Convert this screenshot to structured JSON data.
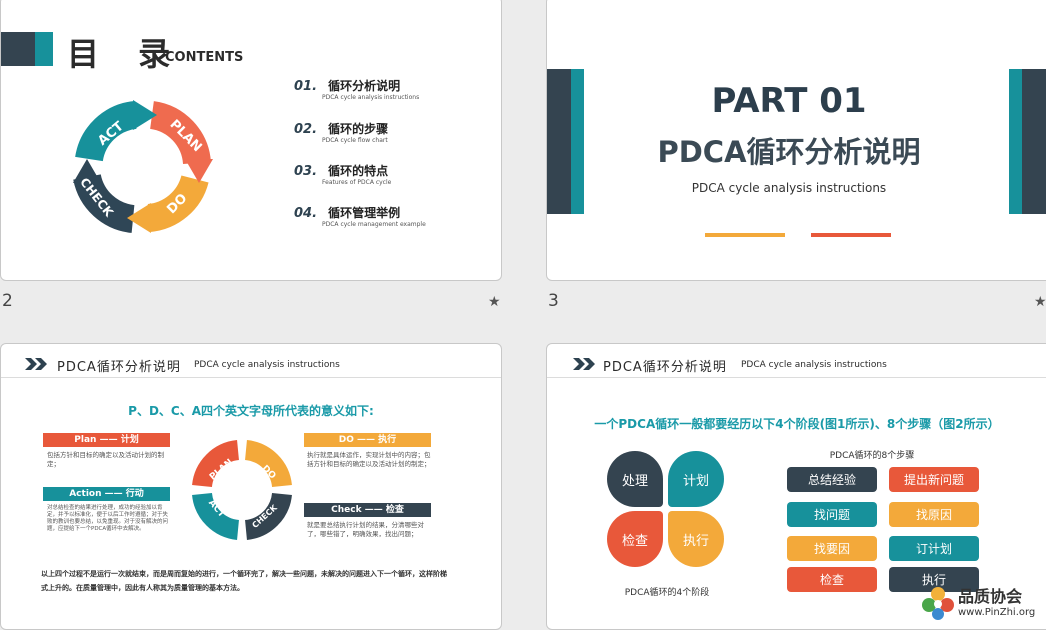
{
  "colors": {
    "teal": "#17919b",
    "navy": "#344450",
    "orange": "#e8583a",
    "yellow": "#f3a93a",
    "coral": "#ef6b4f"
  },
  "slide2": {
    "number": "2",
    "title": "目 录",
    "subtitle": "CONTENTS",
    "cycle": {
      "act": "ACT",
      "plan": "PLAN",
      "do": "DO",
      "check": "CHECK"
    },
    "items": [
      {
        "num": "01.",
        "label": "循环分析说明",
        "en": "PDCA cycle analysis instructions"
      },
      {
        "num": "02.",
        "label": "循环的步骤",
        "en": "PDCA cycle flow chart"
      },
      {
        "num": "03.",
        "label": "循环的特点",
        "en": "Features of PDCA cycle"
      },
      {
        "num": "04.",
        "label": "循环管理举例",
        "en": "PDCA cycle management example"
      }
    ]
  },
  "slide3": {
    "number": "3",
    "part": "PART 01",
    "title": "PDCA循环分析说明",
    "subtitle": "PDCA cycle analysis instructions"
  },
  "slide4": {
    "header_cn": "PDCA循环分析说明",
    "header_en": "PDCA cycle analysis instructions",
    "question": "P、D、C、A四个英文字母所代表的意义如下:",
    "plan": {
      "tag": "Plan —— 计划",
      "desc": "包括方针和目标的确定以及活动计划的制定；"
    },
    "action": {
      "tag": "Action —— 行动",
      "desc": "对总结检查的结果进行处理，成功的经验加以肯定，并予以标准化，便于以后工作时遵循；对于失败的教训也要总结，以免重现。对于没有解决的问题，应提给下一个PDCA循环中去解决。"
    },
    "do": {
      "tag": "DO —— 执行",
      "desc": "执行就是具体运作，实现计划中的内容；包括方针和目标的确定以及活动计划的制定；"
    },
    "check": {
      "tag": "Check —— 检查",
      "desc": "就是要总结执行计划的结果，分清哪些对了，哪些错了，明确效果，找出问题；"
    },
    "cycle": {
      "plan": "PLAN",
      "do": "DO",
      "check": "CHECK",
      "act": "ACT"
    },
    "footer": "以上四个过程不是运行一次就结束，而是周而复始的进行，一个循环完了，解决一些问题，未解决的问题进入下一个循环，这样阶梯式上升的。在质量管理中，因此有人称其为质量管理的基本方法。"
  },
  "slide5": {
    "header_cn": "PDCA循环分析说明",
    "header_en": "PDCA cycle analysis instructions",
    "question": "一个PDCA循环一般都要经历以下4个阶段(图1所示)、8个步骤（图2所示）",
    "phases": {
      "chuli": "处理",
      "jihua": "计划",
      "jiancha": "检查",
      "zhixing": "执行"
    },
    "phases_caption": "PDCA循环的4个阶段",
    "steps_title": "PDCA循环的8个步骤",
    "steps": [
      "总结经验",
      "提出新问题",
      "找问题",
      "找原因",
      "找要因",
      "订计划",
      "检查",
      "执行"
    ]
  },
  "watermark": {
    "name": "品质协会",
    "url": "www.PinZhi.org"
  }
}
